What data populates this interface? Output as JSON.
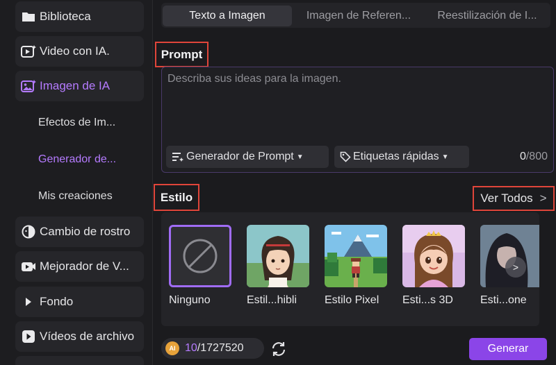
{
  "sidebar": {
    "items": [
      {
        "label": "Biblioteca",
        "icon": "folder-icon"
      },
      {
        "label": "Video con IA.",
        "icon": "video-ai-icon"
      },
      {
        "label": "Imagen de IA",
        "icon": "image-ai-icon"
      },
      {
        "label": "Cambio de rostro",
        "icon": "face-swap-icon"
      },
      {
        "label": "Mejorador de V...",
        "icon": "video-enhance-icon"
      },
      {
        "label": "Fondo",
        "icon": "play-triangle-icon"
      },
      {
        "label": "Vídeos de archivo",
        "icon": "stock-video-icon"
      }
    ],
    "subitems": [
      {
        "label": "Efectos de Im..."
      },
      {
        "label": "Generador de..."
      },
      {
        "label": "Mis creaciones"
      }
    ],
    "active_color": "#b57bff"
  },
  "tabs": [
    {
      "label": "Texto a Imagen"
    },
    {
      "label": "Imagen de Referen..."
    },
    {
      "label": "Reestilización de I..."
    }
  ],
  "prompt": {
    "label": "Prompt",
    "placeholder": "Describa sus ideas para la imagen.",
    "generator_label": "Generador de Prompt",
    "tags_label": "Etiquetas rápidas",
    "count": "0",
    "max": "/800"
  },
  "style": {
    "label": "Estilo",
    "see_all": "Ver Todos",
    "cards": [
      {
        "name": "Ninguno"
      },
      {
        "name": "Estil...hibli"
      },
      {
        "name": "Estilo Pixel"
      },
      {
        "name": "Esti...s 3D"
      },
      {
        "name": "Esti...one"
      }
    ]
  },
  "footer": {
    "ai_badge": "AI",
    "credits_used": "10",
    "credits_total": "/1727520",
    "generate_label": "Generar"
  },
  "colors": {
    "accent": "#8b45e8",
    "highlight_box": "#e0453a",
    "selected_border": "#a06cf5"
  }
}
